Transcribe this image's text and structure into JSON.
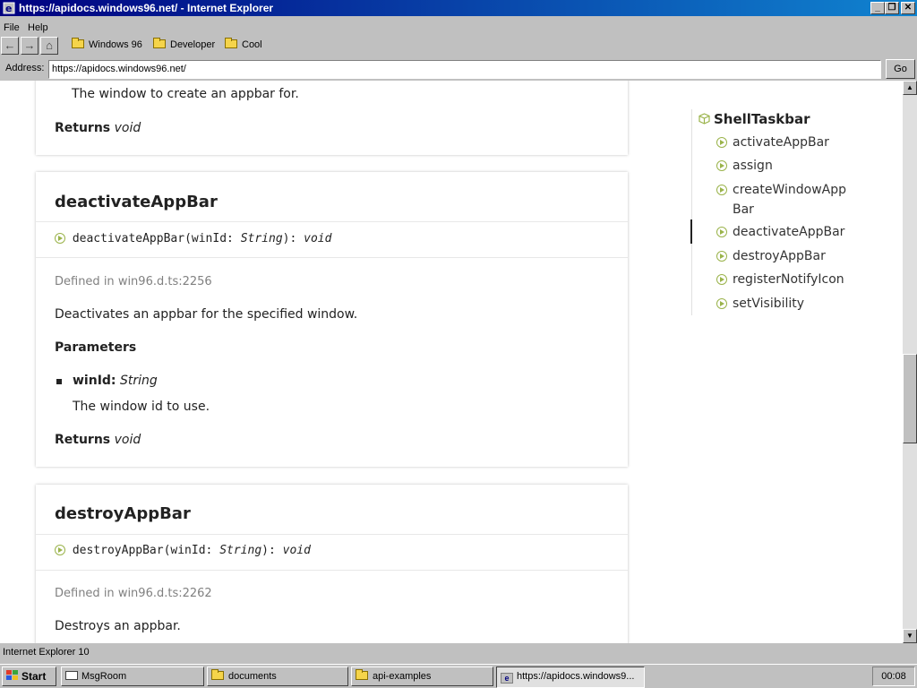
{
  "window": {
    "title": "https://apidocs.windows96.net/ - Internet Explorer",
    "controls": [
      "_",
      "❐",
      "✕"
    ]
  },
  "menu": [
    "File",
    "Help"
  ],
  "toolbar": {
    "back": "←",
    "forward": "→",
    "home": "⌂",
    "links": [
      "Windows 96",
      "Developer",
      "Cool"
    ]
  },
  "address": {
    "label": "Address:",
    "value": "https://apidocs.windows96.net/",
    "go": "Go"
  },
  "content": {
    "prev_card": {
      "param_desc": "The window to create an appbar for.",
      "returns_label": "Returns",
      "returns_type": "void"
    },
    "deactivate": {
      "title": "deactivateAppBar",
      "sig_name": "deactivateAppBar",
      "sig_open": "(winId: ",
      "sig_type": "String",
      "sig_close": "): ",
      "sig_ret": "void",
      "defined_prefix": "Defined in ",
      "defined_src": "win96.d.ts:2256",
      "description": "Deactivates an appbar for the specified window.",
      "params_heading": "Parameters",
      "param_name": "winId:",
      "param_type": "String",
      "param_desc": "The window id to use.",
      "returns_label": "Returns",
      "returns_type": "void"
    },
    "destroy": {
      "title": "destroyAppBar",
      "sig_name": "destroyAppBar",
      "sig_open": "(winId: ",
      "sig_type": "String",
      "sig_close": "): ",
      "sig_ret": "void",
      "defined_prefix": "Defined in ",
      "defined_src": "win96.d.ts:2262",
      "description": "Destroys an appbar."
    }
  },
  "nav": {
    "title": "ShellTaskbar",
    "items": [
      "activateAppBar",
      "assign",
      "createWindowApp",
      "Bar",
      "deactivateAppBar",
      "destroyAppBar",
      "registerNotifyIcon",
      "setVisibility"
    ],
    "active_item": "deactivateAppBar"
  },
  "status": "Internet Explorer 10",
  "taskbar": {
    "start": "Start",
    "tasks": [
      "MsgRoom",
      "documents",
      "api-examples",
      "https://apidocs.windows9..."
    ],
    "clock": "00:08"
  },
  "colors": {
    "titlebar_start": "#000080",
    "titlebar_end": "#1084d0",
    "accent_green": "#9ab34a",
    "chrome": "#c0c0c0"
  }
}
